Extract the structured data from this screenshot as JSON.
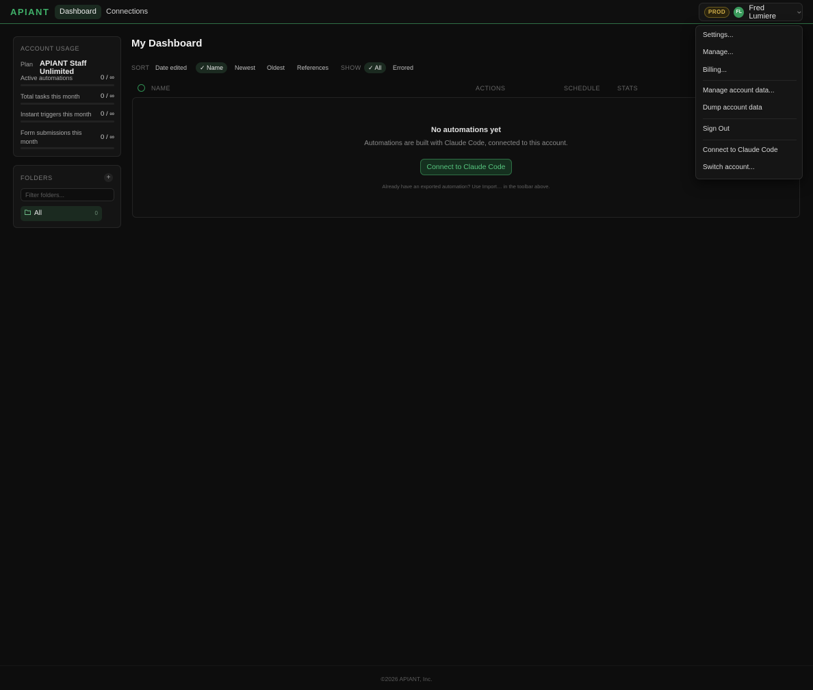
{
  "header": {
    "logo": "APIANT",
    "tabs": [
      {
        "label": "Dashboard",
        "active": true
      },
      {
        "label": "Connections",
        "active": false
      }
    ],
    "env_badge": "PROD",
    "user_initials": "FL",
    "user_name": "Fred Lumiere"
  },
  "account_usage": {
    "title": "ACCOUNT USAGE",
    "plan_label": "Plan",
    "plan_value": "APIANT Staff Unlimited",
    "rows": [
      {
        "label": "Active automations",
        "value": "0 / ∞",
        "fraction": 0
      },
      {
        "label": "Total tasks this month",
        "value": "0 / ∞",
        "fraction": 0
      },
      {
        "label": "Instant triggers this month",
        "value": "0 / ∞",
        "fraction": 0
      },
      {
        "label": "Form submissions this month",
        "value": "0 / ∞",
        "fraction": 0
      }
    ]
  },
  "folders": {
    "title": "FOLDERS",
    "add_icon": "+",
    "filter_placeholder": "Filter folders...",
    "items": [
      {
        "label": "All",
        "count": "0"
      }
    ]
  },
  "main": {
    "title": "My Dashboard",
    "sort_label": "SORT",
    "sort_options": [
      "Date edited",
      "✓ Name",
      "Newest",
      "Oldest",
      "References"
    ],
    "show_label": "SHOW",
    "show_options": [
      "✓ All",
      "Errored"
    ],
    "columns": [
      "NAME",
      "ACTIONS",
      "SCHEDULE",
      "STATS"
    ],
    "empty": {
      "title": "No automations yet",
      "subtitle": "Automations are built with Claude Code, connected to this account.",
      "button": "Connect to Claude Code",
      "hint": "Already have an exported automation? Use Import… in the toolbar above."
    }
  },
  "menu": {
    "items": [
      "Settings...",
      "Manage...",
      "Billing...",
      "Manage account data...",
      "Dump account data",
      "Sign Out",
      "Connect to Claude Code",
      "Switch account..."
    ]
  },
  "footer": {
    "text": "©2026 APIANT, Inc."
  },
  "colors": {
    "accent": "#3fae68",
    "background": "#0d0d0d",
    "prod_badge": "#d6b24a"
  }
}
